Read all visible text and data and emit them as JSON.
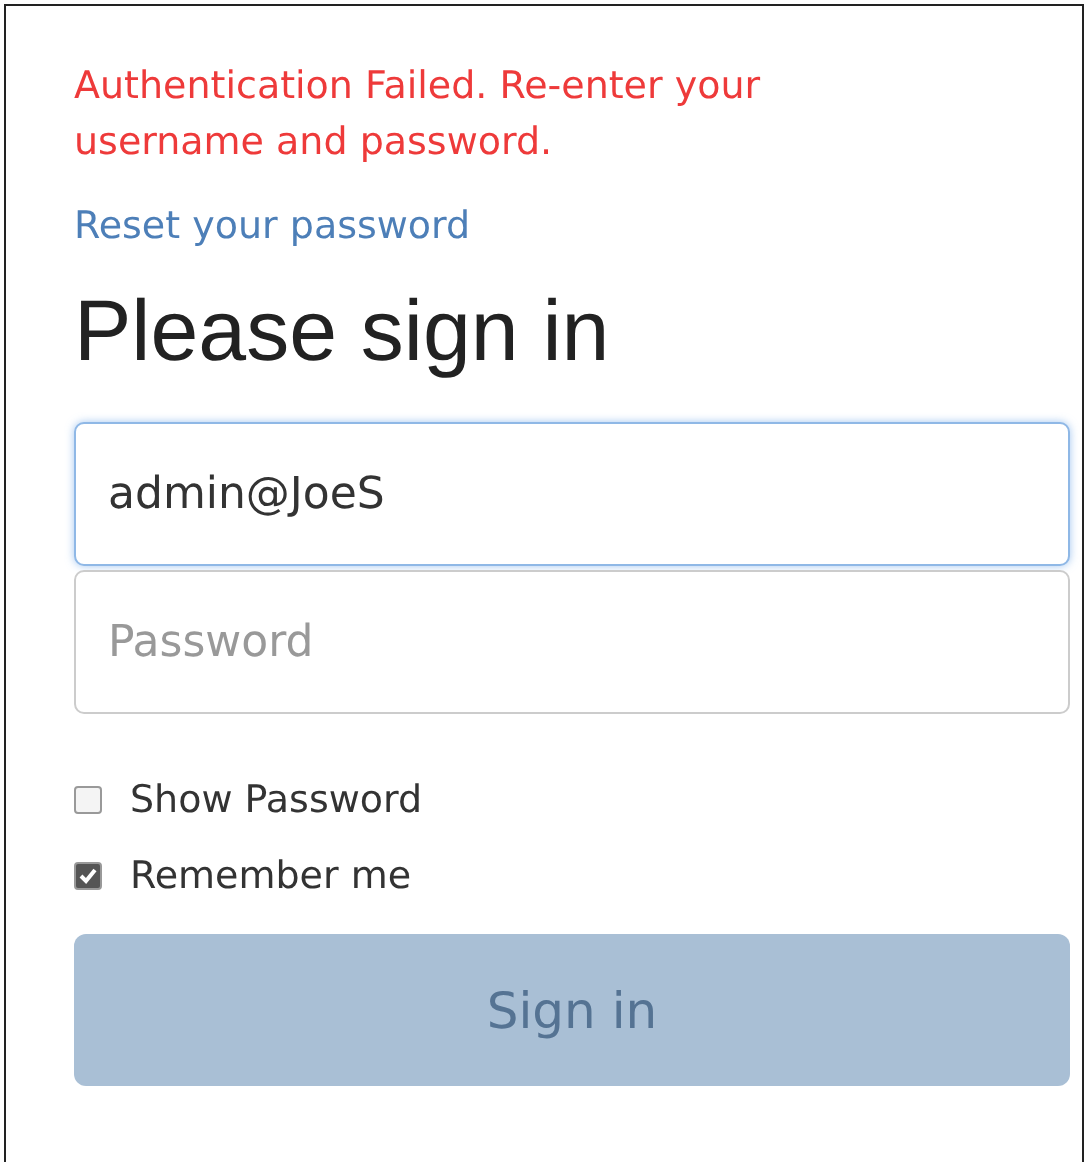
{
  "error_message": "Authentication Failed. Re-enter your username and password.",
  "reset_link": "Reset your password",
  "heading": "Please sign in",
  "fields": [
    {
      "kind": "email",
      "value": "admin@JoeS",
      "focused": true
    },
    {
      "kind": "password",
      "placeholder": "Password",
      "focused": false
    }
  ],
  "checkboxes": [
    {
      "label": "Show Password",
      "checked": false
    },
    {
      "label": "Remember me",
      "checked": true
    }
  ],
  "submit_button": {
    "label": "Sign in",
    "disabled": true
  }
}
